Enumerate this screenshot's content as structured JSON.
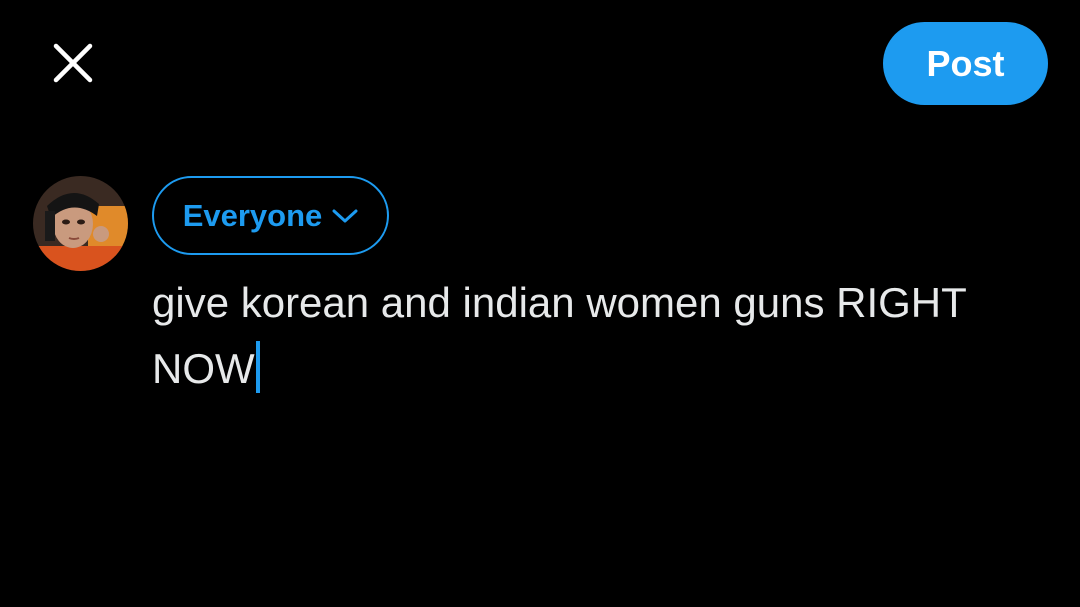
{
  "header": {
    "close_icon": "close-icon",
    "post_label": "Post",
    "accent_color": "#1d9bf0"
  },
  "composer": {
    "avatar_icon": "avatar",
    "audience_label": "Everyone",
    "audience_icon": "chevron-down-icon",
    "text": "give korean and indian women guns RIGHT NOW"
  }
}
